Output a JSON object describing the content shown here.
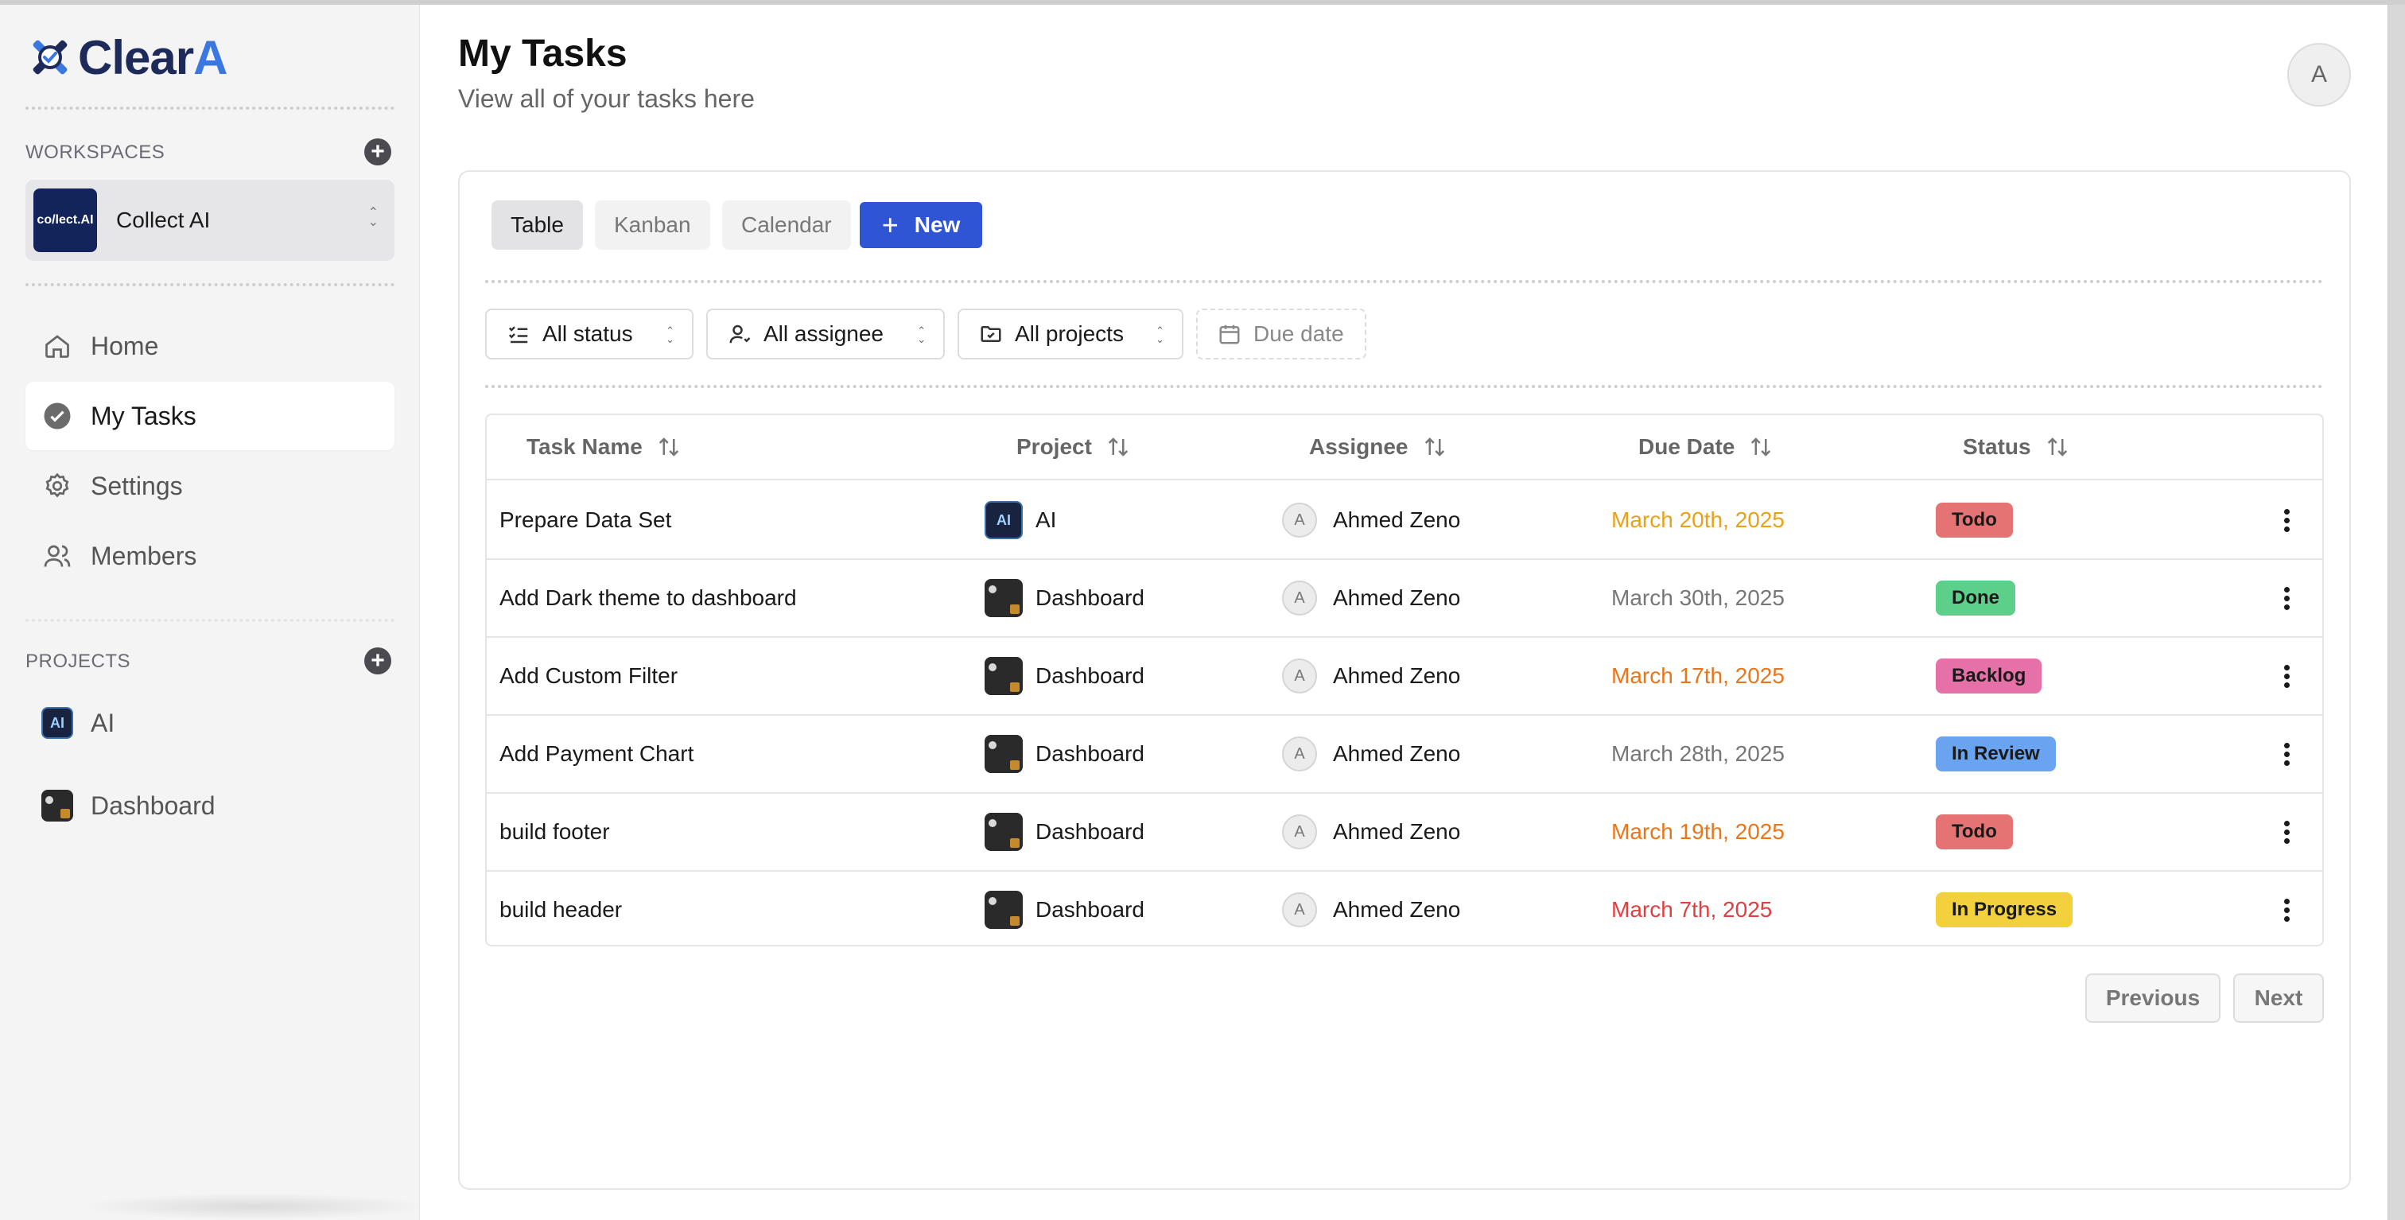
{
  "brand": {
    "name_main": "Clear",
    "name_accent": "A"
  },
  "sidebar": {
    "workspaces_label": "WORKSPACES",
    "workspace": {
      "name": "Collect AI",
      "logo_text": "co/lect.AI"
    },
    "nav": [
      {
        "label": "Home",
        "icon": "home-icon"
      },
      {
        "label": "My Tasks",
        "icon": "check-circle-icon",
        "active": true
      },
      {
        "label": "Settings",
        "icon": "gear-icon"
      },
      {
        "label": "Members",
        "icon": "users-icon"
      }
    ],
    "projects_label": "PROJECTS",
    "projects": [
      {
        "label": "AI",
        "thumb_text": "AI"
      },
      {
        "label": "Dashboard"
      }
    ]
  },
  "header": {
    "title": "My Tasks",
    "subtitle": "View all of your tasks here",
    "avatar_initial": "A"
  },
  "views": {
    "tabs": [
      "Table",
      "Kanban",
      "Calendar"
    ],
    "active": "Table",
    "new_label": "New"
  },
  "filters": {
    "status": "All status",
    "assignee": "All assignee",
    "projects": "All projects",
    "due_date": "Due date"
  },
  "table": {
    "columns": [
      "Task Name",
      "Project",
      "Assignee",
      "Due Date",
      "Status"
    ],
    "rows": [
      {
        "task": "Prepare Data Set",
        "project": "AI",
        "assignee": "Ahmed Zeno",
        "assignee_initial": "A",
        "due": "March 20th, 2025",
        "due_color": "#e8a21a",
        "status": "Todo",
        "status_color": "#e57373"
      },
      {
        "task": "Add Dark theme to dashboard",
        "project": "Dashboard",
        "assignee": "Ahmed Zeno",
        "assignee_initial": "A",
        "due": "March 30th, 2025",
        "due_color": "#777777",
        "status": "Done",
        "status_color": "#5ccf8a"
      },
      {
        "task": "Add Custom Filter",
        "project": "Dashboard",
        "assignee": "Ahmed Zeno",
        "assignee_initial": "A",
        "due": "March 17th, 2025",
        "due_color": "#e8761a",
        "status": "Backlog",
        "status_color": "#e571a8"
      },
      {
        "task": "Add Payment Chart",
        "project": "Dashboard",
        "assignee": "Ahmed Zeno",
        "assignee_initial": "A",
        "due": "March 28th, 2025",
        "due_color": "#777777",
        "status": "In Review",
        "status_color": "#6aa3f0"
      },
      {
        "task": "build footer",
        "project": "Dashboard",
        "assignee": "Ahmed Zeno",
        "assignee_initial": "A",
        "due": "March 19th, 2025",
        "due_color": "#e8761a",
        "status": "Todo",
        "status_color": "#e57373"
      },
      {
        "task": "build header",
        "project": "Dashboard",
        "assignee": "Ahmed Zeno",
        "assignee_initial": "A",
        "due": "March 7th, 2025",
        "due_color": "#e04040",
        "status": "In Progress",
        "status_color": "#f2d13c"
      }
    ]
  },
  "pagination": {
    "previous": "Previous",
    "next": "Next"
  },
  "colors": {
    "primary": "#2f55d4",
    "sidebar_bg": "#f4f4f5"
  }
}
